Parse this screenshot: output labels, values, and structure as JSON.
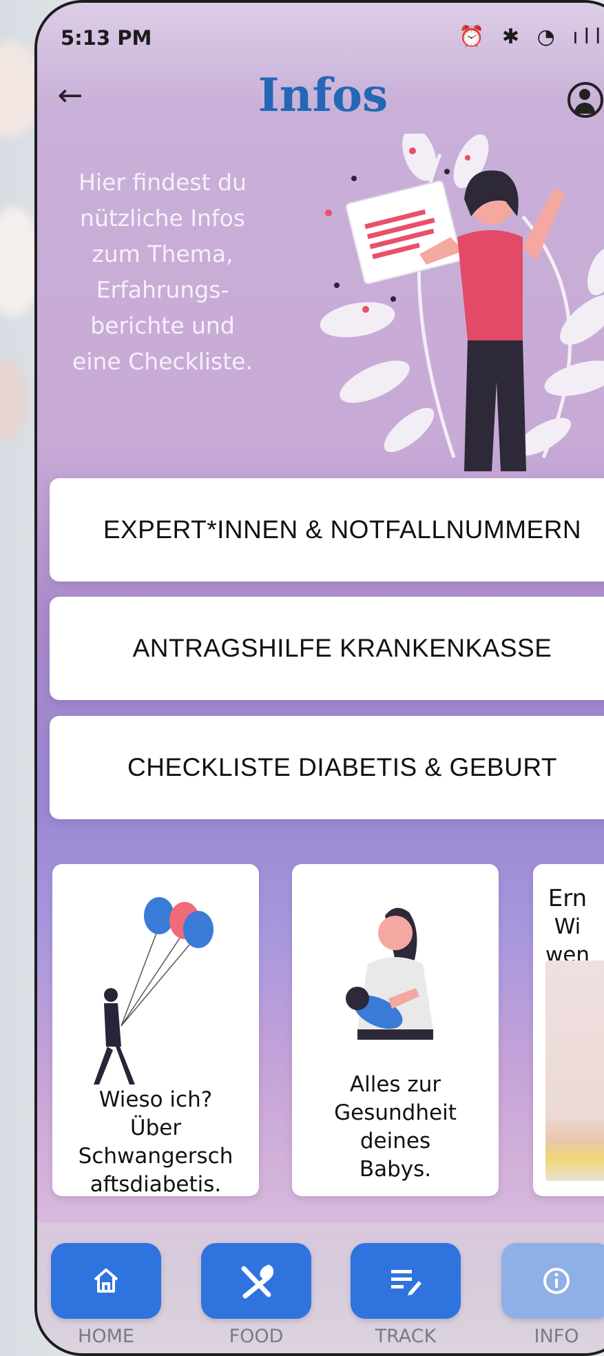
{
  "status_bar": {
    "time": "5:13 PM",
    "icons": "⏰ ✱ ◔ ıll ▭"
  },
  "header": {
    "title": "Infos"
  },
  "intro": {
    "lines": [
      "Hier findest du",
      "nützliche Infos",
      "zum Thema,",
      "Erfahrungs-",
      "berichte und",
      "eine Checkliste."
    ]
  },
  "menu": [
    {
      "label": "EXPERT*INNEN & NOTFALLNUMMERN"
    },
    {
      "label": "ANTRAGSHILFE KRANKENKASSE"
    },
    {
      "label": "CHECKLISTE DIABETIS & GEBURT"
    }
  ],
  "cards": [
    {
      "lines": [
        "Wieso ich?",
        "Über",
        "Schwangersch",
        "aftsdiabetis."
      ]
    },
    {
      "lines": [
        "Alles zur",
        "Gesundheit",
        "deines",
        "Babys."
      ]
    },
    {
      "lines": [
        "Ern",
        "Wi",
        "wen"
      ]
    }
  ],
  "nav": [
    {
      "label": "HOME",
      "icon": "home-icon"
    },
    {
      "label": "FOOD",
      "icon": "fork-spoon-icon"
    },
    {
      "label": "TRACK",
      "icon": "track-list-icon"
    },
    {
      "label": "INFO",
      "icon": "info-icon"
    }
  ],
  "colors": {
    "title": "#2467b5",
    "nav_button": "#2f73df",
    "nav_active": "#8fb0e6"
  }
}
